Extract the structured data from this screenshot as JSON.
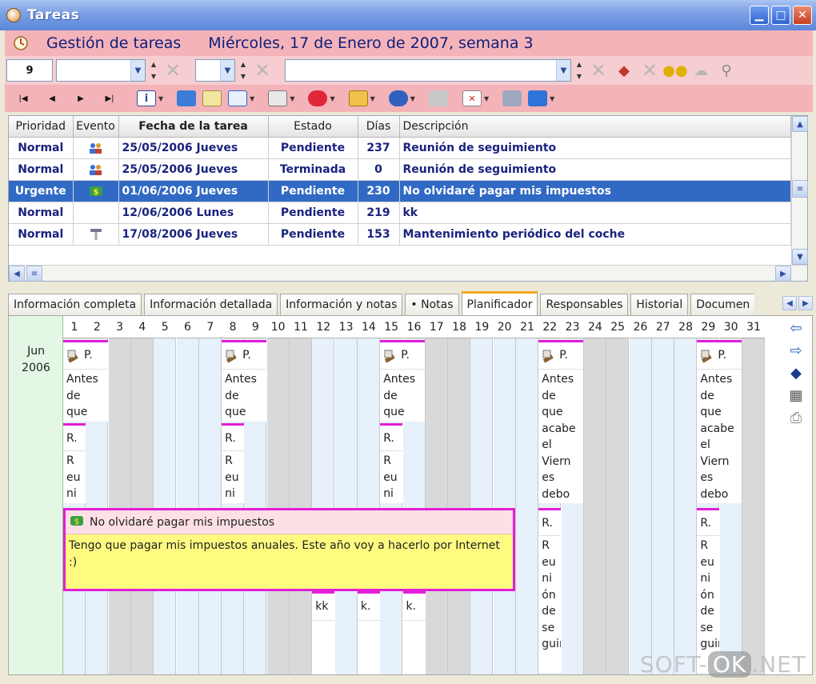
{
  "window": {
    "title": "Tareas"
  },
  "header": {
    "title": "Gestión de tareas",
    "date": "Miércoles, 17 de Enero de 2007, semana 3"
  },
  "filter": {
    "count": "9"
  },
  "table": {
    "columns": [
      "Prioridad",
      "Evento",
      "Fecha de la tarea",
      "Estado",
      "Días",
      "Descripción"
    ],
    "rows": [
      {
        "priority": "Normal",
        "date": "25/05/2006 Jueves",
        "status": "Pendiente",
        "days": "237",
        "description": "Reunión de seguimiento"
      },
      {
        "priority": "Normal",
        "date": "25/05/2006 Jueves",
        "status": "Terminada",
        "days": "0",
        "description": "Reunión de seguimiento"
      },
      {
        "priority": "Urgente",
        "date": "01/06/2006 Jueves",
        "status": "Pendiente",
        "days": "230",
        "description": "No olvidaré pagar mis impuestos"
      },
      {
        "priority": "Normal",
        "date": "12/06/2006 Lunes",
        "status": "Pendiente",
        "days": "219",
        "description": "kk"
      },
      {
        "priority": "Normal",
        "date": "17/08/2006 Jueves",
        "status": "Pendiente",
        "days": "153",
        "description": "Mantenimiento periódico del coche"
      }
    ]
  },
  "tabs": [
    "Información completa",
    "Información detallada",
    "Información y notas",
    "• Notas",
    "Planificador",
    "Responsables",
    "Historial",
    "Documen"
  ],
  "planner": {
    "month": "Jun",
    "year": "2006",
    "days": [
      "1",
      "2",
      "3",
      "4",
      "5",
      "6",
      "7",
      "8",
      "9",
      "10",
      "11",
      "12",
      "13",
      "14",
      "15",
      "16",
      "17",
      "18",
      "19",
      "20",
      "21",
      "22",
      "23",
      "24",
      "25",
      "26",
      "27",
      "28",
      "29",
      "30",
      "31"
    ],
    "short_head": "P.",
    "short_r": "R.",
    "note_short": "Antes\nde\nque",
    "note_long": "Antes\nde\nque\nacabe\nel\nViern\nes\ndebo",
    "reuni_short": "R\neu\nni",
    "reuni_long": "R\neu\nni\nón\nde\nse\nguim",
    "urgent_title": "No olvidaré pagar mis impuestos",
    "urgent_body": "Tengo que pagar mis impuestos anuales. Este año voy a hacerlo por Internet :)",
    "kk": "kk",
    "k": "k."
  },
  "watermark": {
    "left": "SOFT-",
    "mid": "OK",
    "right": ".NET"
  }
}
